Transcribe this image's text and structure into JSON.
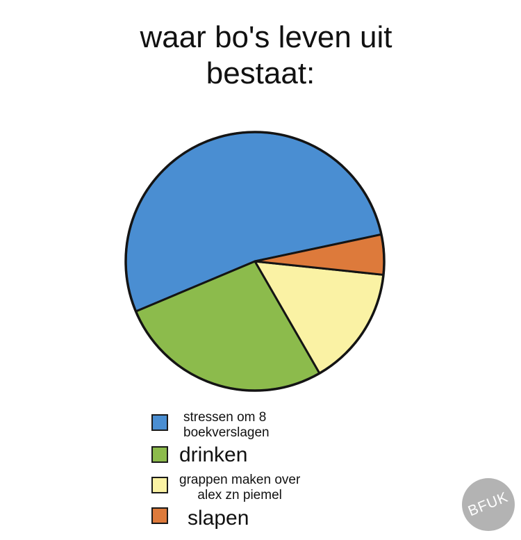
{
  "chart_data": {
    "type": "pie",
    "title": "waar bo's leven uit bestaat:",
    "title_lines": [
      "waar bo's leven uit",
      "bestaat:"
    ],
    "slices": [
      {
        "label": "stressen om 8 boekverslagen",
        "label_lines": [
          "stressen om 8",
          "boekverslagen"
        ],
        "value": 53,
        "color": "#4a8ed2"
      },
      {
        "label": "drinken",
        "label_lines": [
          "drinken"
        ],
        "value": 27,
        "color": "#8cbb4c"
      },
      {
        "label": "grappen maken over alex zn piemel",
        "label_lines": [
          "grappen maken over",
          "alex zn piemel"
        ],
        "value": 15,
        "color": "#faf2a4"
      },
      {
        "label": "slapen",
        "label_lines": [
          "slapen"
        ],
        "value": 5,
        "color": "#dd7a3b"
      }
    ],
    "start_angle_deg": -12,
    "direction": "counterclockwise",
    "legend_position": "bottom"
  },
  "watermark": {
    "text": "BFUK"
  }
}
